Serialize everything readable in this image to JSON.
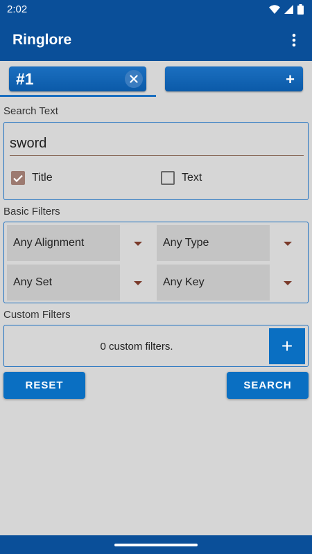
{
  "status_bar": {
    "time": "2:02",
    "icons": [
      "wifi-icon",
      "signal-icon",
      "battery-icon"
    ]
  },
  "app_bar": {
    "title": "Ringlore",
    "overflow_icon": "more-vert-icon"
  },
  "tabs": {
    "active_label": "#1",
    "close_icon": "close-icon",
    "add_label": "+"
  },
  "search": {
    "section_label": "Search Text",
    "value": "sword",
    "options": [
      {
        "label": "Title",
        "checked": true
      },
      {
        "label": "Text",
        "checked": false
      }
    ]
  },
  "basic_filters": {
    "section_label": "Basic Filters",
    "dropdowns": [
      {
        "label": "Any Alignment"
      },
      {
        "label": "Any Type"
      },
      {
        "label": "Any Set"
      },
      {
        "label": "Any Key"
      }
    ]
  },
  "custom_filters": {
    "section_label": "Custom Filters",
    "summary": "0 custom filters.",
    "add_label": "+"
  },
  "actions": {
    "reset_label": "RESET",
    "search_label": "SEARCH"
  },
  "colors": {
    "primary_dark": "#0a4f99",
    "primary": "#0a6fc2",
    "background": "#d6d6d6",
    "checkbox_checked": "#9c7a70",
    "dropdown_arrow": "#7a3a2a"
  }
}
